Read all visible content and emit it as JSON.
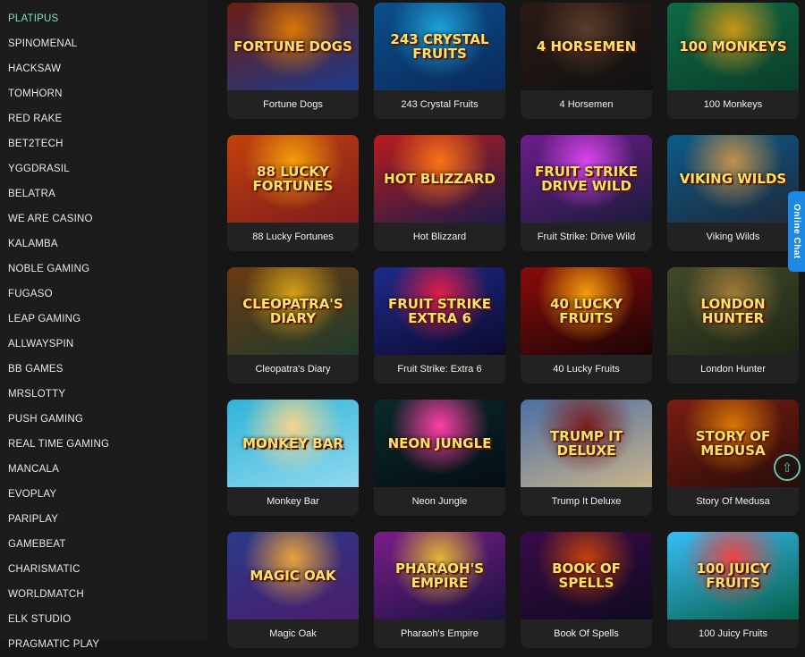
{
  "sidebar": {
    "items": [
      "PLATIPUS",
      "SPINOMENAL",
      "HACKSAW",
      "TOMHORN",
      "RED RAKE",
      "BET2TECH",
      "YGGDRASIL",
      "BELATRA",
      "WE ARE CASINO",
      "KALAMBA",
      "NOBLE GAMING",
      "FUGASO",
      "LEAP GAMING",
      "ALLWAYSPIN",
      "BB GAMES",
      "MRSLOTTY",
      "PUSH GAMING",
      "REAL TIME GAMING",
      "MANCALA",
      "EVOPLAY",
      "PARIPLAY",
      "GAMEBEAT",
      "CHARISMATIC",
      "WORLDMATCH",
      "ELK STUDIO",
      "PRAGMATIC PLAY"
    ]
  },
  "games": [
    {
      "title": "Fortune Dogs",
      "logo": "FORTUNE DOGS",
      "bg": [
        "#6b1d12",
        "#1e3a8a",
        "#d97706"
      ]
    },
    {
      "title": "243 Crystal Fruits",
      "logo": "243 CRYSTAL FRUITS",
      "bg": [
        "#0b4f8a",
        "#0a2a5c",
        "#1ea0d8"
      ]
    },
    {
      "title": "4 Horsemen",
      "logo": "4 HORSEMEN",
      "bg": [
        "#2b1a14",
        "#111111",
        "#5a3b2b"
      ]
    },
    {
      "title": "100 Monkeys",
      "logo": "100 MONKEYS",
      "bg": [
        "#0e6b45",
        "#0b3d2a",
        "#c99516"
      ]
    },
    {
      "title": "88 Lucky Fortunes",
      "logo": "88 LUCKY FORTUNES",
      "bg": [
        "#c2410c",
        "#7f1d1d",
        "#f59e0b"
      ]
    },
    {
      "title": "Hot Blizzard",
      "logo": "HOT BLIZZARD",
      "bg": [
        "#b91c1c",
        "#1e1b4b",
        "#f97316"
      ]
    },
    {
      "title": "Fruit Strike: Drive Wild",
      "logo": "FRUIT STRIKE DRIVE WILD",
      "bg": [
        "#6d1d8c",
        "#1b1b3a",
        "#d946ef"
      ]
    },
    {
      "title": "Viking Wilds",
      "logo": "VIKING WILDS",
      "bg": [
        "#0c5b8a",
        "#1e293b",
        "#c2914a"
      ]
    },
    {
      "title": "Cleopatra's Diary",
      "logo": "CLEOPATRA'S DIARY",
      "bg": [
        "#6b3a12",
        "#1f3b2c",
        "#d4a017"
      ]
    },
    {
      "title": "Fruit Strike: Extra 6",
      "logo": "FRUIT STRIKE EXTRA 6",
      "bg": [
        "#1e2a8a",
        "#0b0b2e",
        "#e11d48"
      ]
    },
    {
      "title": "40 Lucky Fruits",
      "logo": "40 LUCKY FRUITS",
      "bg": [
        "#8a0b0b",
        "#1a0505",
        "#f59e0b"
      ]
    },
    {
      "title": "London Hunter",
      "logo": "LONDON HUNTER",
      "bg": [
        "#3f4a2a",
        "#1f2614",
        "#a07a3a"
      ]
    },
    {
      "title": "Monkey Bar",
      "logo": "MONKEY BAR",
      "bg": [
        "#2fb4d9",
        "#8fd9ef",
        "#f4d58d"
      ]
    },
    {
      "title": "Neon Jungle",
      "logo": "NEON JUNGLE",
      "bg": [
        "#0a2a2a",
        "#050d14",
        "#ff3fa8"
      ]
    },
    {
      "title": "Trump It Deluxe",
      "logo": "TRUMP IT DELUXE",
      "bg": [
        "#4a6fa5",
        "#c9b48a",
        "#7a1d1d"
      ]
    },
    {
      "title": "Story Of Medusa",
      "logo": "STORY OF MEDUSA",
      "bg": [
        "#7a1d12",
        "#2a0c08",
        "#d97706"
      ]
    },
    {
      "title": "Magic Oak",
      "logo": "MAGIC OAK",
      "bg": [
        "#2a3a8a",
        "#4a1d6b",
        "#e8a33a"
      ]
    },
    {
      "title": "Pharaoh's Empire",
      "logo": "PHARAOH'S EMPIRE",
      "bg": [
        "#7a1d8a",
        "#1b1240",
        "#e5b534"
      ]
    },
    {
      "title": "Book Of Spells",
      "logo": "BOOK OF SPELLS",
      "bg": [
        "#3a0b4a",
        "#0f0a1e",
        "#c2410c"
      ]
    },
    {
      "title": "100 Juicy Fruits",
      "logo": "100 JUICY FRUITS",
      "bg": [
        "#38bdf8",
        "#065f46",
        "#ef4444"
      ]
    }
  ],
  "chat": {
    "label": "Online Chat"
  },
  "scroll": {
    "icon": "arrow-up-icon"
  }
}
